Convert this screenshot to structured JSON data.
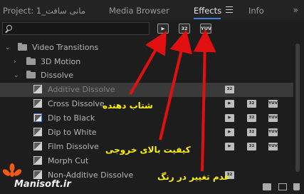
{
  "tabs": {
    "project": "Project: 1_مانی سافت",
    "media_browser": "Media Browser",
    "effects": "Effects",
    "info": "Info",
    "expand": "»"
  },
  "search": {
    "value": "",
    "placeholder": ""
  },
  "filters": {
    "accelerated": "▶",
    "bit32": "32",
    "yuv": "YUV"
  },
  "tree": {
    "video_transitions": "Video Transitions",
    "motion_3d": "3D Motion",
    "dissolve": "Dissolve",
    "items": [
      {
        "label": "Additive Dissolve",
        "badges": [
          "32"
        ]
      },
      {
        "label": "Cross Dissolve",
        "badges": [
          "▶",
          "32",
          "YUV"
        ]
      },
      {
        "label": "Dip to Black",
        "badges": [
          "▶",
          "32",
          "YUV"
        ]
      },
      {
        "label": "Dip to White",
        "badges": [
          "▶",
          "32",
          "YUV"
        ]
      },
      {
        "label": "Film Dissolve",
        "badges": [
          "▶",
          "32",
          "YUV"
        ]
      },
      {
        "label": "Morph Cut",
        "badges": []
      },
      {
        "label": "Non-Additive Dissolve",
        "badges": [
          "32"
        ]
      }
    ]
  },
  "annotations": {
    "accelerated": "شتاب دهنده",
    "high_quality": "کیفیت بالای خروجی",
    "no_color_change": "عدم تغییر در رنگ"
  },
  "brand": {
    "text": "Manisoft.ir"
  },
  "colors": {
    "accent": "#3c82dc",
    "annotation": "#fff200",
    "arrow": "#e01010",
    "logo": "#f05a14"
  }
}
